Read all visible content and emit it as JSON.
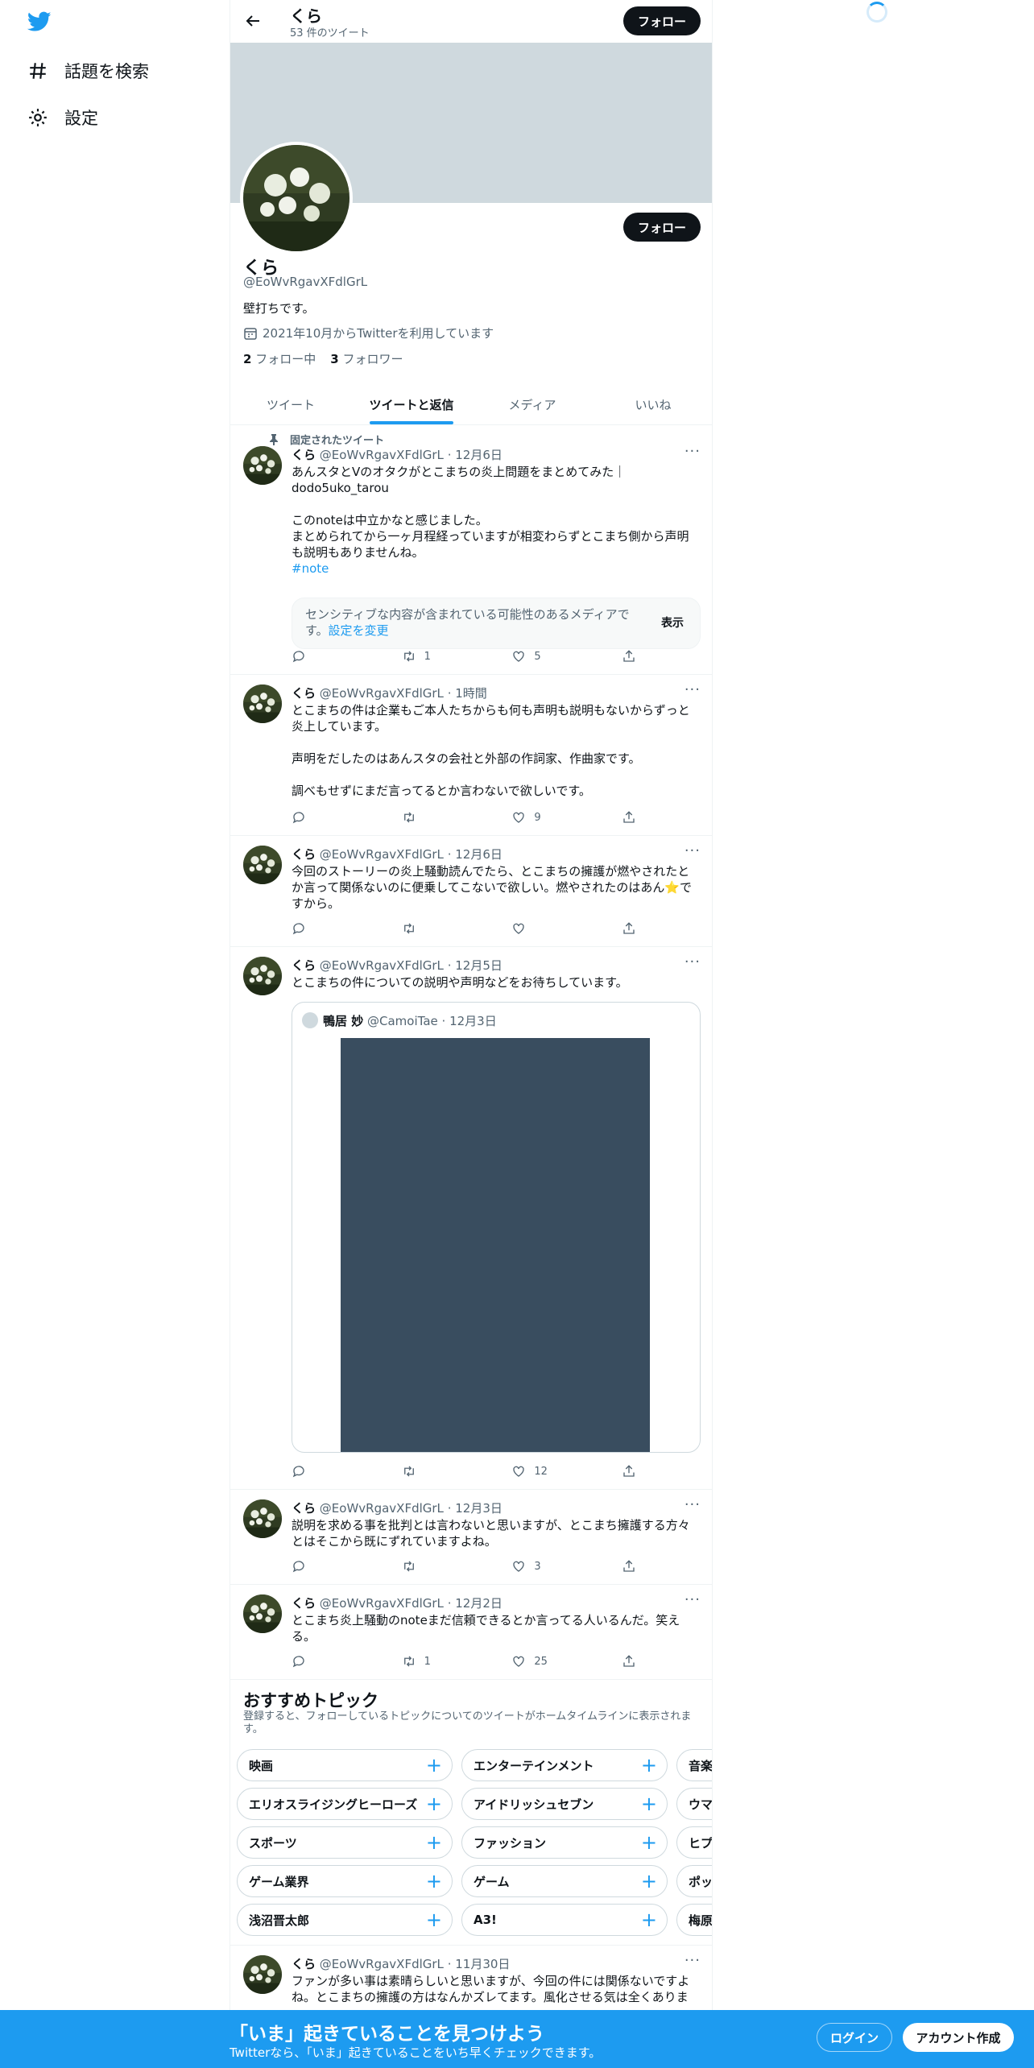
{
  "nav": {
    "explore_label": "話題を検索",
    "settings_label": "設定"
  },
  "header": {
    "name": "くら",
    "tweet_count": "53 件のツイート",
    "follow_label": "フォロー"
  },
  "profile": {
    "name": "くら",
    "handle": "@EoWvRgavXFdlGrL",
    "bio": "壁打ちです。",
    "joined": "2021年10月からTwitterを利用しています",
    "following_count": "2",
    "following_label": "フォロー中",
    "followers_count": "3",
    "followers_label": "フォロワー",
    "follow_label": "フォロー"
  },
  "tabs": [
    "ツイート",
    "ツイートと返信",
    "メディア",
    "いいね"
  ],
  "pinned_label": "固定されたツイート",
  "tweets": [
    {
      "name": "くら",
      "handle": "@EoWvRgavXFdlGrL",
      "time": "12月6日",
      "lines": [
        "あんスタとVのオタクがとこまちの炎上問題をまとめてみた｜dodo5uko_tarou",
        "",
        "このnoteは中立かなと感じました。",
        "まとめられてから一ヶ月程経っていますが相変わらずとこまち側から声明も説明もありませんね。"
      ],
      "hashtag": "#note",
      "sensitive_text": "センシティブな内容が含まれている可能性のあるメディアです。",
      "sensitive_link": "設定を変更",
      "sensitive_show": "表示",
      "reply": "",
      "retweet": "1",
      "like": "5"
    },
    {
      "name": "くら",
      "handle": "@EoWvRgavXFdlGrL",
      "time": "1時間",
      "lines": [
        "とこまちの件は企業もご本人たちからも何も声明も説明もないからずっと炎上しています。",
        "",
        "声明をだしたのはあんスタの会社と外部の作詞家、作曲家です。",
        "",
        "調べもせずにまだ言ってるとか言わないで欲しいです。"
      ],
      "reply": "",
      "retweet": "",
      "like": "9"
    },
    {
      "name": "くら",
      "handle": "@EoWvRgavXFdlGrL",
      "time": "12月6日",
      "lines": [
        "今回のストーリーの炎上騒動読んでたら、とこまちの擁護が燃やされたとか言って関係ないのに便乗してこないで欲しい。燃やされたのはあん⭐️ですから。"
      ],
      "reply": "",
      "retweet": "",
      "like": ""
    },
    {
      "name": "くら",
      "handle": "@EoWvRgavXFdlGrL",
      "time": "12月5日",
      "lines": [
        "とこまちの件についての説明や声明などをお待ちしています。"
      ],
      "quote": {
        "name": "鴨居 妙",
        "handle": "@CamoiTae",
        "time": "12月3日"
      },
      "reply": "",
      "retweet": "",
      "like": "12"
    },
    {
      "name": "くら",
      "handle": "@EoWvRgavXFdlGrL",
      "time": "12月3日",
      "lines": [
        "説明を求める事を批判とは言わないと思いますが、とこまち擁護する方々とはそこから既にずれていますよね。"
      ],
      "reply": "",
      "retweet": "",
      "like": "3"
    },
    {
      "name": "くら",
      "handle": "@EoWvRgavXFdlGrL",
      "time": "12月2日",
      "lines": [
        "とこまち炎上騒動のnoteまだ信頼できるとか言ってる人いるんだ。笑える。"
      ],
      "reply": "",
      "retweet": "1",
      "like": "25"
    },
    {
      "name": "くら",
      "handle": "@EoWvRgavXFdlGrL",
      "time": "11月30日",
      "lines": [
        "ファンが多い事は素晴らしいと思いますが、今回の件には関係ないですよね。とこまちの擁護の方はなんかズレてます。風化させる気は全くありま"
      ]
    }
  ],
  "topics": {
    "title": "おすすめトピック",
    "subtitle": "登録すると、フォローしているトピックについてのツイートがホームタイムラインに表示されます。",
    "rows": [
      [
        "映画",
        "エンターテインメント",
        "音楽ニュース"
      ],
      [
        "エリオスライジングヒーローズ",
        "アイドリッシュセブン",
        "ウマ娘 プリティーダービー"
      ],
      [
        "スポーツ",
        "ファッション",
        "ヒプノシスマイク"
      ],
      [
        "ゲーム業界",
        "ゲーム",
        "ポップ"
      ],
      [
        "浅沼晋太郎",
        "A3!",
        "梅原裕一郎"
      ]
    ]
  },
  "bottom_bar": {
    "title": "「いま」起きていることを見つけよう",
    "subtitle": "Twitterなら、「いま」起きていることをいち早くチェックできます。",
    "login_label": "ログイン",
    "signup_label": "アカウント作成"
  },
  "colors": {
    "accent": "#1d9bf0",
    "banner": "#cfd9de",
    "dark": "#0f1419"
  }
}
